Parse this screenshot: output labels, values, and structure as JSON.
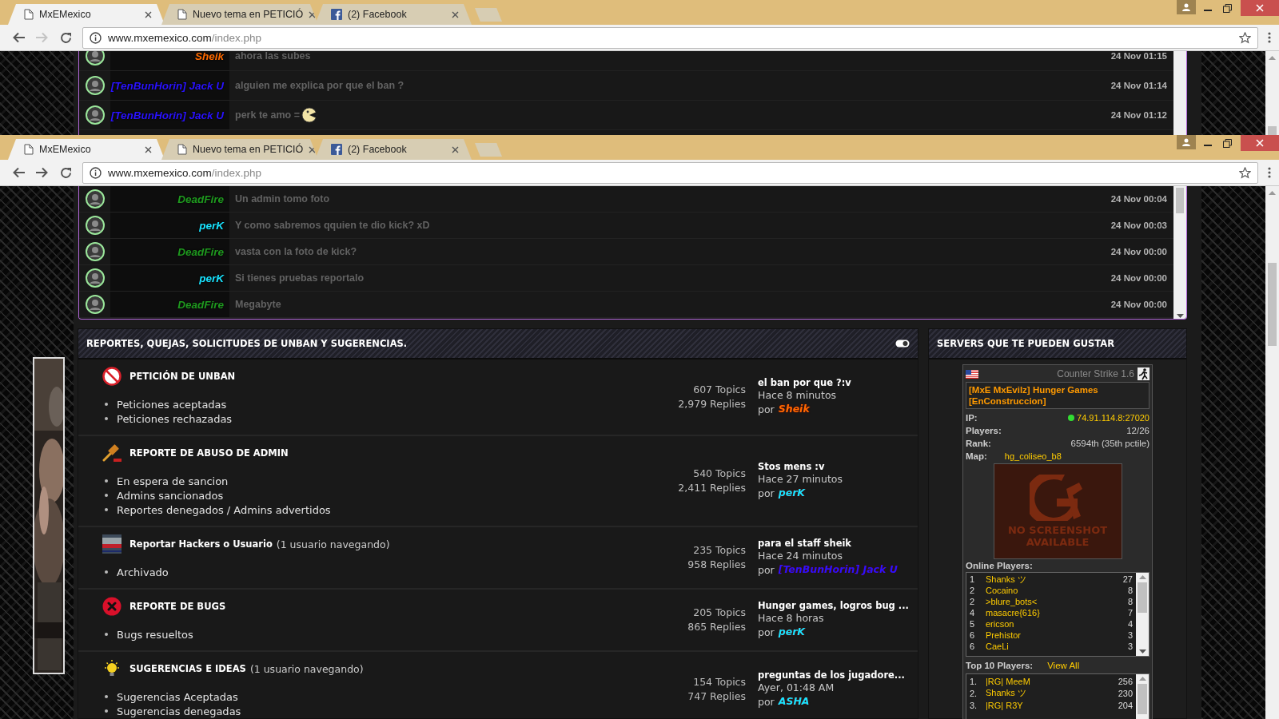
{
  "windows": [
    {
      "tabs": [
        {
          "kind": "page",
          "title": "MxEMexico",
          "selected": true
        },
        {
          "kind": "page",
          "title": "Nuevo tema en PETICIÓ",
          "selected": false
        },
        {
          "kind": "social",
          "title": "(2) Facebook",
          "selected": false
        }
      ],
      "address": {
        "host": "www.mxemexico.com",
        "path": "/index.php"
      },
      "forward_enabled": false,
      "chat": [
        {
          "name": "Sheik",
          "color": "#ff6a00",
          "message": "ahora las subes",
          "emoticon": false,
          "time": "24 Nov 01:15"
        },
        {
          "name": "[TenBunHorin] Jack U",
          "color": "#2a12ff",
          "message": "alguien me explica por que el ban ?",
          "emoticon": false,
          "time": "24 Nov 01:14"
        },
        {
          "name": "[TenBunHorin] Jack U",
          "color": "#2a12ff",
          "message": "perk te amo =",
          "emoticon": true,
          "time": "24 Nov 01:12"
        }
      ]
    },
    {
      "tabs": [
        {
          "kind": "page",
          "title": "MxEMexico",
          "selected": true
        },
        {
          "kind": "page",
          "title": "Nuevo tema en PETICIÓ",
          "selected": false
        },
        {
          "kind": "social",
          "title": "(2) Facebook",
          "selected": false
        }
      ],
      "address": {
        "host": "www.mxemexico.com",
        "path": "/index.php"
      },
      "forward_enabled": true,
      "chat": [
        {
          "name": "DeadFire",
          "color": "#1f9a1f",
          "message": "Un admin tomo foto",
          "emoticon": false,
          "time": "24 Nov 00:04"
        },
        {
          "name": "perK",
          "color": "#19e3ff",
          "message": "Y como sabremos qquien te dio kick? xD",
          "emoticon": false,
          "time": "24 Nov 00:03"
        },
        {
          "name": "DeadFire",
          "color": "#1f9a1f",
          "message": "vasta con la foto de kick?",
          "emoticon": false,
          "time": "24 Nov 00:00"
        },
        {
          "name": "perK",
          "color": "#19e3ff",
          "message": "Si tienes pruebas reportalo",
          "emoticon": false,
          "time": "24 Nov 00:00"
        },
        {
          "name": "DeadFire",
          "color": "#1f9a1f",
          "message": "Megabyte",
          "emoticon": false,
          "time": "24 Nov 00:00"
        }
      ],
      "forum": {
        "title": "REPORTES, QUEJAS, SOLICITUDES DE UNBAN Y SUGERENCIAS.",
        "forums": [
          {
            "kind": "ban",
            "title": "PETICIÓN DE UNBAN",
            "subforums": [
              "Peticiones aceptadas",
              "Peticiones rechazadas"
            ],
            "topics": "607 Topics",
            "replies": "2,979 Replies",
            "last_title": "el ban por que ?:v",
            "last_time": "Hace 8 minutos",
            "by": "por",
            "author": "Sheik",
            "color": "#ff6a00"
          },
          {
            "kind": "gavel",
            "title": "REPORTE DE ABUSO DE ADMIN",
            "subforums": [
              "En espera de sancion",
              "Admins sancionados",
              "Reportes denegados / Admins advertidos"
            ],
            "topics": "540 Topics",
            "replies": "2,411 Replies",
            "last_title": "Stos mens :v",
            "last_time": "Hace 27 minutos",
            "by": "por",
            "author": "perK",
            "color": "#19e3ff"
          },
          {
            "kind": "hacker",
            "title": "Reportar Hackers o Usuario",
            "viewers": "(1 usuario navegando)",
            "subforums": [
              "Archivado"
            ],
            "topics": "235 Topics",
            "replies": "958 Replies",
            "last_title": "para el staff sheik",
            "last_time": "Hace 24 minutos",
            "by": "por",
            "author": "[TenBunHorin] Jack U",
            "color": "#2a12ff"
          },
          {
            "kind": "bug",
            "title": "REPORTE DE BUGS",
            "subforums": [
              "Bugs resueltos"
            ],
            "topics": "205 Topics",
            "replies": "865 Replies",
            "last_title": "Hunger games, logros bug ...",
            "last_time": "Hace 8 horas",
            "by": "por",
            "author": "perK",
            "color": "#19e3ff"
          },
          {
            "kind": "idea",
            "title": "SUGERENCIAS E IDEAS",
            "viewers": "(1 usuario navegando)",
            "subforums": [
              "Sugerencias Aceptadas",
              "Sugerencias denegadas"
            ],
            "topics": "154 Topics",
            "replies": "747 Replies",
            "last_title": "preguntas de los jugadore...",
            "last_time": "Ayer, 01:48 AM",
            "by": "por",
            "author": "ASHA",
            "color": "#19e3ff"
          }
        ]
      },
      "servers": {
        "title": "SERVERS QUE TE PUEDEN GUSTAR",
        "server": {
          "game": "Counter Strike 1.6",
          "name": "[MxE MxEvilz] Hunger Games [EnConstruccion]",
          "online": true,
          "stats": [
            {
              "kind": "address",
              "label": "IP:",
              "value": "74.91.114.8:27020"
            },
            {
              "kind": "plain",
              "label": "Players:",
              "value": "12/26"
            },
            {
              "kind": "plain",
              "label": "Rank:",
              "value": "6594th (35th pctile)"
            },
            {
              "kind": "map",
              "label": "Map:",
              "value": "hg_coliseo_b8"
            }
          ],
          "map_image_text": "NO SCREENSHOT AVAILABLE",
          "online_label": "Online Players:",
          "online_players": [
            {
              "rank": "1",
              "name": "Shanks ツ",
              "score": "27"
            },
            {
              "rank": "2",
              "name": "Cocaino",
              "score": "8"
            },
            {
              "rank": "2",
              "name": ">blure_bots<",
              "score": "8"
            },
            {
              "rank": "4",
              "name": "masacre{616}",
              "score": "7"
            },
            {
              "rank": "5",
              "name": "ericson",
              "score": "4"
            },
            {
              "rank": "6",
              "name": "Prehistor",
              "score": "3"
            },
            {
              "rank": "6",
              "name": "CaeLi",
              "score": "3"
            }
          ],
          "top_label": "Top 10 Players:",
          "view_all": "View All",
          "top_players": [
            {
              "rank": "1.",
              "name": "|RG| MeeM",
              "score": "256"
            },
            {
              "rank": "2.",
              "name": "Shanks ツ",
              "score": "230"
            },
            {
              "rank": "3.",
              "name": "|RG| R3Y",
              "score": "204"
            }
          ]
        }
      }
    }
  ]
}
